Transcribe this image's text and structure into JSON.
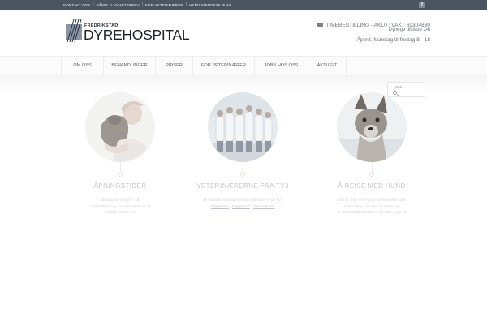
{
  "topbar": {
    "links": [
      "KONTAKT OSS",
      "PÅMELD NYHETSBREV",
      "FOR VETERINÆRER",
      "HENVISNINGSSKJEMA"
    ],
    "facebook": "f"
  },
  "header": {
    "logo_small": "FREDRIKSTAD",
    "logo_big": "DYREHOSPITAL",
    "phone_line": "TIMEBESTILLING - AKUTTVAKT 69304830",
    "vet_line": "Dyrlege tilstede 24t",
    "hours_line": "Åpent: Mandag til fredag 8 - 18"
  },
  "nav": {
    "items": [
      "OM OSS",
      "BEHANDLINGER",
      "PRISER",
      "FOR VETERINÆRER",
      "JOBB HOS OSS",
      "AKTUELT"
    ]
  },
  "search": {
    "placeholder": "Søk"
  },
  "columns": [
    {
      "title": "ÅPNINGSTIDER",
      "lines": [
        "Mandag til fredag 8 - 18",
        "Timebestilling og dagvakt: 69 30 48 30",
        "Dyrlege tilstede 24t"
      ]
    },
    {
      "title": "VETERINÆRERNE FRA TV3",
      "lines": [
        "Se hvordan hverdagen er for veterinærene på TV3"
      ],
      "links": [
        "Klippet nr 1",
        "Klippet nr 2",
        "Veterinærene"
      ]
    },
    {
      "title": "Å REISE MED HUND",
      "lines": [
        "Skal du reise med hund i sommer eller høst,",
        "er det viktig å ha med alt papirer og",
        "at nødvendige vaksiner er på plass i god tid"
      ]
    }
  ],
  "colors": {
    "topbar": "#4b5562",
    "heading": "#c4c8cc"
  }
}
